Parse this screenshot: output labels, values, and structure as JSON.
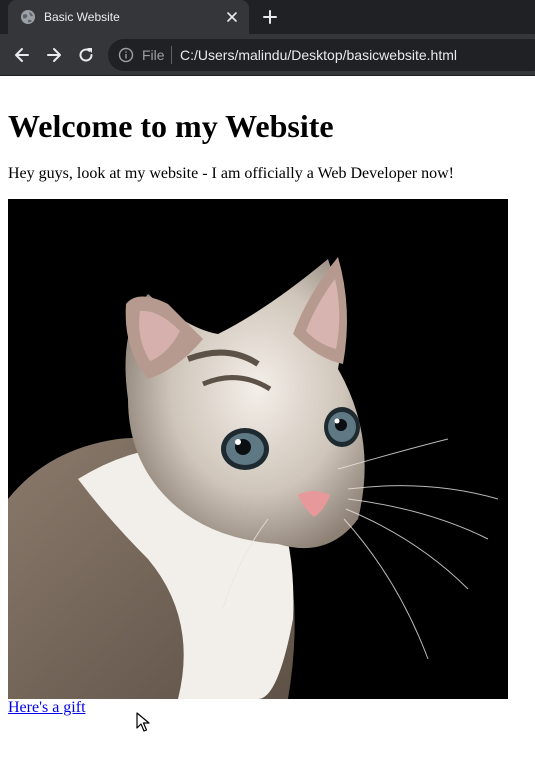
{
  "browser": {
    "tab": {
      "title": "Basic Website",
      "favicon": "globe-icon",
      "close": "close-icon"
    },
    "new_tab": "plus-icon",
    "toolbar": {
      "back": "back-arrow-icon",
      "forward": "forward-arrow-icon",
      "reload": "reload-icon"
    },
    "address_bar": {
      "info_icon": "info-icon",
      "scheme_label": "File",
      "url": "C:/Users/malindu/Desktop/basicwebsite.html"
    },
    "colors": {
      "tabstrip": "#202124",
      "toolbar": "#35363a",
      "omnibox": "#202124",
      "text": "#e8eaed"
    }
  },
  "page": {
    "heading": "Welcome to my Website",
    "paragraph": "Hey guys, look at my website - I am officially a Web Developer now!",
    "image": {
      "subject": "cat-photo",
      "background": "#000000"
    },
    "link": {
      "text": "Here's a gift",
      "color": "#0000ee"
    }
  },
  "cursor": "arrow-cursor-icon"
}
